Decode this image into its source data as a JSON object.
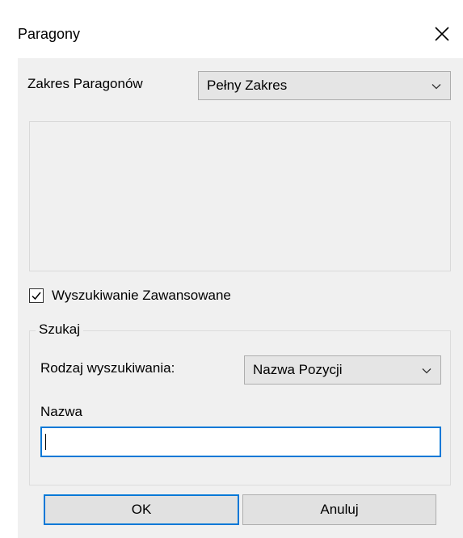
{
  "window": {
    "title": "Paragony"
  },
  "range": {
    "label": "Zakres Paragonów",
    "selected": "Pełny Zakres"
  },
  "advanced": {
    "label": "Wyszukiwanie Zawansowane",
    "checked": true
  },
  "search": {
    "group_label": "Szukaj",
    "type_label": "Rodzaj wyszukiwania:",
    "type_selected": "Nazwa Pozycji",
    "name_label": "Nazwa",
    "name_value": ""
  },
  "buttons": {
    "ok": "OK",
    "cancel": "Anuluj"
  },
  "colors": {
    "accent": "#0078d7",
    "dialog_bg": "#f0f0f0",
    "combo_bg": "#e5e5e5"
  }
}
